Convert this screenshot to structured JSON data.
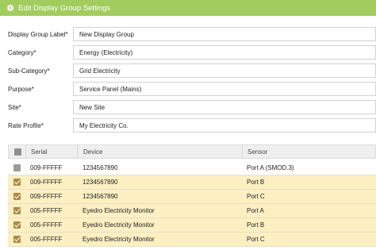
{
  "dialog": {
    "title": "Edit Display Group Settings",
    "header_color": "#a2cc5e"
  },
  "form": {
    "fields": [
      {
        "label": "Display Group Label*",
        "value": "New Display Group"
      },
      {
        "label": "Category*",
        "value": "Energy (Electricity)"
      },
      {
        "label": "Sub-Category*",
        "value": "Grid Electricity"
      },
      {
        "label": "Purpose*",
        "value": "Service Panel (Mains)"
      },
      {
        "label": "Site*",
        "value": "New Site"
      },
      {
        "label": "Rate Profile*",
        "value": "My Electricity Co."
      }
    ]
  },
  "table": {
    "columns": [
      "Serial",
      "Device",
      "Sensor"
    ],
    "rows": [
      {
        "checked": false,
        "serial": "009-FFFFF",
        "device": "1234567890",
        "sensor": "Port A (SMOD.3)"
      },
      {
        "checked": true,
        "serial": "009-FFFFF",
        "device": "1234567890",
        "sensor": "Port B"
      },
      {
        "checked": true,
        "serial": "009-FFFFF",
        "device": "1234567890",
        "sensor": "Port C"
      },
      {
        "checked": true,
        "serial": "005-FFFFF",
        "device": "Eyedro Electricity Monitor",
        "sensor": "Port A"
      },
      {
        "checked": true,
        "serial": "005-FFFFF",
        "device": "Eyedro Electricity Monitor",
        "sensor": "Port B"
      },
      {
        "checked": true,
        "serial": "005-FFFFF",
        "device": "Eyedro Electricity Monitor",
        "sensor": "Port C"
      }
    ],
    "selected_row_color": "#fcefc2",
    "checkbox_checked_color": "#aa8b47"
  },
  "icons": {
    "header": "gear-icon"
  }
}
